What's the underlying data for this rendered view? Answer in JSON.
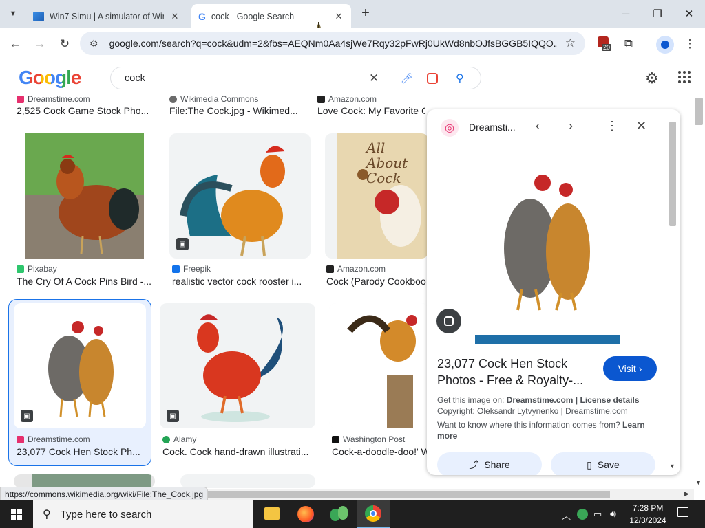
{
  "browser": {
    "tabs": [
      {
        "title": "Win7 Simu | A simulator of Win",
        "close": "✕"
      },
      {
        "title": "cock - Google Search",
        "close": "✕"
      }
    ],
    "new_tab": "+",
    "url": "google.com/search?q=cock&udm=2&fbs=AEQNm0Aa4sjWe7Rqy32pFwRj0UkWd8nbOJfsBGGB5IQQO...",
    "extension_badge": "20",
    "status_url": "https://commons.wikimedia.org/wiki/File:The_Cock.jpg"
  },
  "google": {
    "logo": "Google",
    "query": "cock"
  },
  "results": {
    "row0": [
      {
        "source": "Dreamstime.com",
        "caption": "2,525 Cock Game Stock Pho..."
      },
      {
        "source": "Wikimedia Commons",
        "caption": "File:The Cock.jpg - Wikimed..."
      },
      {
        "source": "Amazon.com",
        "caption": "Love Cock: My Favorite Chic"
      }
    ],
    "row1": [
      {
        "source": "Pixabay",
        "caption": "The Cry Of A Cock Pins Bird -..."
      },
      {
        "source": "Freepik",
        "caption": "realistic vector cock rooster i..."
      },
      {
        "source": "Amazon.com",
        "caption": "Cock (Parody Cookboo"
      }
    ],
    "row2": [
      {
        "source": "Dreamstime.com",
        "caption": "23,077 Cock Hen Stock Ph..."
      },
      {
        "source": "Alamy",
        "caption": "Cock. Cock hand-drawn illustrati..."
      },
      {
        "source": "Washington Post",
        "caption": "Cock-a-doodle-doo!' W"
      }
    ],
    "book_text": "All About Cock"
  },
  "panel": {
    "source": "Dreamsti...",
    "title": "23,077 Cock Hen Stock Photos - Free & Royalty-...",
    "visit": "Visit",
    "get_image_prefix": "Get this image on:",
    "get_image_site": "Dreamstime.com",
    "license": "License details",
    "copyright": "Copyright: Oleksandr Lytvynenko | Dreamstime.com",
    "info_q": "Want to know where this information comes from?",
    "learn_more": "Learn more",
    "share": "Share",
    "save": "Save"
  },
  "taskbar": {
    "search_placeholder": "Type here to search",
    "time": "7:28 PM",
    "date": "12/3/2024"
  },
  "colors": {
    "tabbar": "#dde3ea",
    "accent_blue": "#0b57d0",
    "selected_border": "#1a73e8"
  }
}
